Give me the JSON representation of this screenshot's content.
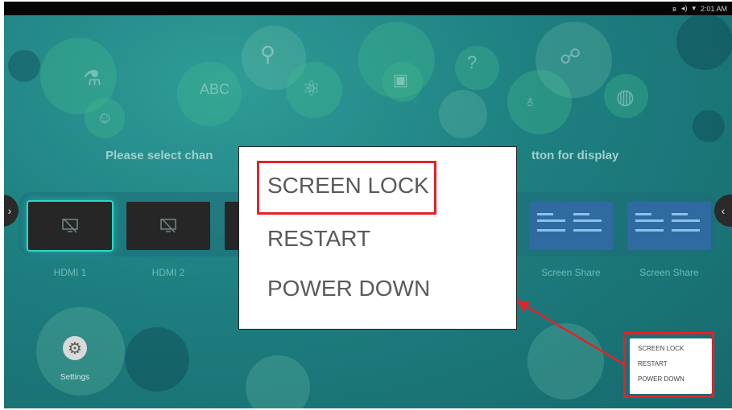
{
  "status_bar": {
    "time": "2:01 AM",
    "icons": [
      "bluetooth-icon",
      "volume-icon",
      "wifi-icon"
    ]
  },
  "headline": {
    "left_fragment": "Please select chan",
    "right_fragment": "tton for display"
  },
  "channels": [
    {
      "label": "HDMI 1",
      "icon": "no-signal-icon",
      "selected": true
    },
    {
      "label": "HDMI 2",
      "icon": "no-signal-icon",
      "selected": false
    },
    {
      "label": "",
      "icon": "no-signal-icon",
      "selected": false
    },
    {
      "label": "Screen Share",
      "icon": "screen-share-preview",
      "selected": false
    },
    {
      "label": "Screen Share",
      "icon": "screen-share-preview",
      "selected": false
    }
  ],
  "settings": {
    "label": "Settings",
    "icon": "gear-icon"
  },
  "power_menu": {
    "items": [
      "SCREEN LOCK",
      "RESTART",
      "POWER DOWN"
    ]
  },
  "zoom_menu": {
    "items": [
      "SCREEN LOCK",
      "RESTART",
      "POWER DOWN"
    ],
    "highlighted": "SCREEN LOCK"
  },
  "colors": {
    "background": "#1e7f80",
    "highlight": "#e2232a",
    "selected_glow": "#2ad7c4",
    "menu_bg": "#ffffff"
  }
}
